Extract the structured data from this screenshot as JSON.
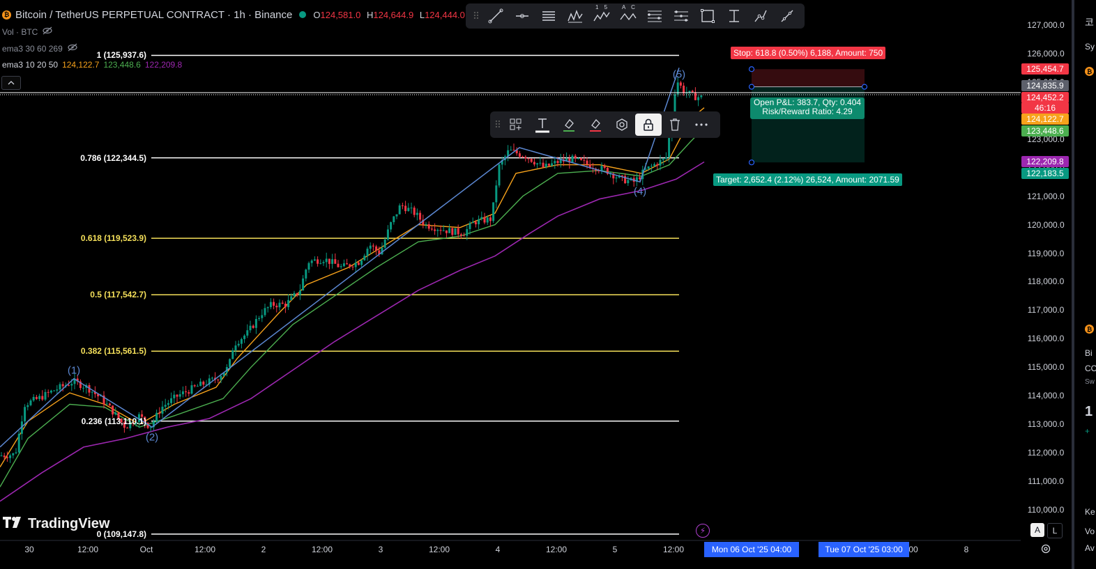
{
  "header": {
    "symbol": "Bitcoin / TetherUS PERPETUAL CONTRACT · 1h · Binance",
    "ohlc": [
      {
        "k": "O",
        "v": "124,581.0"
      },
      {
        "k": "H",
        "v": "124,644.9"
      },
      {
        "k": "L",
        "v": "124,444.0"
      }
    ]
  },
  "indicators": {
    "vol": "Vol · BTC",
    "ema_a": "ema3 30 60 269",
    "ema_b": "ema3 10 20 50",
    "ema_b_values": [
      {
        "value": "124,122.7",
        "color": "#f7a21b"
      },
      {
        "value": "123,448.6",
        "color": "#4caf50"
      },
      {
        "value": "122,209.8",
        "color": "#9c27b0"
      }
    ]
  },
  "collapse_icon": "chevron-up-icon",
  "drawing_toolbar": {
    "tools": [
      "trend-line-icon",
      "ray-icon",
      "parallel-channel-icon",
      "pitchfork-icon",
      "elliott-impulse-icon",
      "elliott-correction-icon",
      "fib-retracement-icon",
      "fib-extension-icon",
      "rectangle-icon",
      "price-range-icon",
      "path-icon",
      "brush-icon"
    ],
    "wave_labels_a": "1 5",
    "wave_labels_b": "A C"
  },
  "edit_toolbar": {
    "tools": [
      "templates-icon",
      "text-icon",
      "line-color-icon",
      "fill-color-icon",
      "settings-icon",
      "lock-icon",
      "trash-icon",
      "more-icon"
    ]
  },
  "price_axis": {
    "labels": [
      "127,000.0",
      "126,000.0",
      "125,000.0",
      "124,000.0",
      "123,000.0",
      "122,000.0",
      "121,000.0",
      "120,000.0",
      "119,000.0",
      "118,000.0",
      "117,000.0",
      "116,000.0",
      "115,000.0",
      "114,000.0",
      "113,000.0",
      "112,000.0",
      "111,000.0",
      "110,000.0"
    ],
    "tags": [
      {
        "text": "125,454.7",
        "bg": "#f23645"
      },
      {
        "text": "124,835.9",
        "bg": "#5d606b"
      },
      {
        "text": "124,452.2",
        "bg": "#f23645"
      },
      {
        "text": "46:16",
        "bg": "#f23645"
      },
      {
        "text": "124,122.7",
        "bg": "#f7a21b"
      },
      {
        "text": "123,448.6",
        "bg": "#4caf50"
      },
      {
        "text": "122,209.8",
        "bg": "#9c27b0"
      },
      {
        "text": "122,183.5",
        "bg": "#089981"
      }
    ]
  },
  "time_axis": {
    "labels": [
      "30",
      "12:00",
      "Oct",
      "12:00",
      "2",
      "12:00",
      "3",
      "12:00",
      "4",
      "12:00",
      "5",
      "12:00",
      "00",
      "8"
    ],
    "crosshair_start": "Mon 06 Oct '25   04:00",
    "crosshair_end": "Tue 07 Oct '25   03:00"
  },
  "fibonacci": [
    {
      "label": "1 (125,937.6)",
      "price": 125937.6,
      "color": "#ffffff"
    },
    {
      "label": "0.786 (122,344.5)",
      "price": 122344.5,
      "color": "#ffffff"
    },
    {
      "label": "0.618 (119,523.9)",
      "price": 119523.9,
      "color": "#f5e05a"
    },
    {
      "label": "0.5 (117,542.7)",
      "price": 117542.7,
      "color": "#f5e05a"
    },
    {
      "label": "0.382 (115,561.5)",
      "price": 115561.5,
      "color": "#f5e05a"
    },
    {
      "label": "0.236 (113,110.1)",
      "price": 113110.1,
      "color": "#ffffff"
    },
    {
      "label": "0 (109,147.8)",
      "price": 109147.8,
      "color": "#ffffff"
    }
  ],
  "elliott_waves": [
    {
      "label": "(1)"
    },
    {
      "label": "(2)"
    },
    {
      "label": "(4)"
    },
    {
      "label": "(5)"
    }
  ],
  "position": {
    "stop": "Stop: 618.8 (0.50%) 6,188, Amount: 750",
    "pnl_line1": "Open P&L: 383.7, Qty: 0.404",
    "pnl_line2": "Risk/Reward Ratio: 4.29",
    "target": "Target: 2,652.4 (2.12%) 26,524, Amount: 2071.59",
    "entry_price": 124835.9,
    "stop_price": 125454.7,
    "target_price": 122183.5
  },
  "watermark": "TradingView",
  "bolt_icon": "lightning-icon",
  "buttons": {
    "auto": "A",
    "log": "L"
  },
  "settings_icon": "gear-icon",
  "right_panel": {
    "items": [
      "코",
      "Sy",
      "Bi",
      "CO",
      "Sw",
      "1",
      "+",
      "Ke",
      "Vo",
      "Av"
    ]
  },
  "colors": {
    "up": "#089981",
    "down": "#f23645",
    "ema_fast": "#f7a21b",
    "ema_mid": "#4caf50",
    "ema_slow": "#9c27b0",
    "wave_line": "#5b87d1"
  },
  "chart_data": {
    "type": "candlestick",
    "timeframe": "1h",
    "ylim": [
      109500,
      127400
    ],
    "close_path": [
      {
        "x": 0,
        "y": 111900
      },
      {
        "x": 22,
        "y": 111950
      },
      {
        "x": 35,
        "y": 113700
      },
      {
        "x": 55,
        "y": 113900
      },
      {
        "x": 78,
        "y": 114200
      },
      {
        "x": 105,
        "y": 114500
      },
      {
        "x": 125,
        "y": 114300
      },
      {
        "x": 145,
        "y": 113900
      },
      {
        "x": 160,
        "y": 113500
      },
      {
        "x": 180,
        "y": 112900
      },
      {
        "x": 200,
        "y": 113300
      },
      {
        "x": 215,
        "y": 112900
      },
      {
        "x": 232,
        "y": 113600
      },
      {
        "x": 255,
        "y": 114000
      },
      {
        "x": 280,
        "y": 114300
      },
      {
        "x": 310,
        "y": 114600
      },
      {
        "x": 328,
        "y": 115000
      },
      {
        "x": 335,
        "y": 115800
      },
      {
        "x": 355,
        "y": 116200
      },
      {
        "x": 375,
        "y": 116900
      },
      {
        "x": 390,
        "y": 117200
      },
      {
        "x": 410,
        "y": 117200
      },
      {
        "x": 430,
        "y": 117700
      },
      {
        "x": 442,
        "y": 118700
      },
      {
        "x": 465,
        "y": 118800
      },
      {
        "x": 490,
        "y": 118500
      },
      {
        "x": 515,
        "y": 118700
      },
      {
        "x": 530,
        "y": 119300
      },
      {
        "x": 545,
        "y": 119000
      },
      {
        "x": 560,
        "y": 120000
      },
      {
        "x": 575,
        "y": 120700
      },
      {
        "x": 595,
        "y": 120400
      },
      {
        "x": 610,
        "y": 120000
      },
      {
        "x": 640,
        "y": 119800
      },
      {
        "x": 665,
        "y": 119700
      },
      {
        "x": 680,
        "y": 120100
      },
      {
        "x": 705,
        "y": 120200
      },
      {
        "x": 715,
        "y": 122000
      },
      {
        "x": 730,
        "y": 122600
      },
      {
        "x": 755,
        "y": 122400
      },
      {
        "x": 780,
        "y": 122000
      },
      {
        "x": 800,
        "y": 122200
      },
      {
        "x": 820,
        "y": 122300
      },
      {
        "x": 845,
        "y": 122100
      },
      {
        "x": 870,
        "y": 121900
      },
      {
        "x": 890,
        "y": 121600
      },
      {
        "x": 910,
        "y": 121500
      },
      {
        "x": 925,
        "y": 121900
      },
      {
        "x": 945,
        "y": 122200
      },
      {
        "x": 955,
        "y": 122300
      },
      {
        "x": 962,
        "y": 123400
      },
      {
        "x": 970,
        "y": 125100
      },
      {
        "x": 980,
        "y": 124700
      },
      {
        "x": 995,
        "y": 124500
      },
      {
        "x": 1010,
        "y": 124450
      }
    ],
    "ema_fast": [
      {
        "x": 0,
        "y": 111500
      },
      {
        "x": 40,
        "y": 113100
      },
      {
        "x": 100,
        "y": 114100
      },
      {
        "x": 150,
        "y": 113700
      },
      {
        "x": 200,
        "y": 113000
      },
      {
        "x": 250,
        "y": 113700
      },
      {
        "x": 310,
        "y": 114300
      },
      {
        "x": 340,
        "y": 115300
      },
      {
        "x": 400,
        "y": 116900
      },
      {
        "x": 440,
        "y": 117900
      },
      {
        "x": 500,
        "y": 118500
      },
      {
        "x": 560,
        "y": 119400
      },
      {
        "x": 600,
        "y": 120000
      },
      {
        "x": 660,
        "y": 119900
      },
      {
        "x": 710,
        "y": 120400
      },
      {
        "x": 740,
        "y": 121800
      },
      {
        "x": 800,
        "y": 122100
      },
      {
        "x": 860,
        "y": 122100
      },
      {
        "x": 920,
        "y": 121800
      },
      {
        "x": 960,
        "y": 122300
      },
      {
        "x": 990,
        "y": 123700
      },
      {
        "x": 1010,
        "y": 124100
      }
    ],
    "ema_mid": [
      {
        "x": 0,
        "y": 110800
      },
      {
        "x": 40,
        "y": 112500
      },
      {
        "x": 100,
        "y": 113700
      },
      {
        "x": 150,
        "y": 113600
      },
      {
        "x": 200,
        "y": 112900
      },
      {
        "x": 250,
        "y": 113300
      },
      {
        "x": 320,
        "y": 113900
      },
      {
        "x": 360,
        "y": 115000
      },
      {
        "x": 420,
        "y": 116500
      },
      {
        "x": 480,
        "y": 117500
      },
      {
        "x": 540,
        "y": 118500
      },
      {
        "x": 600,
        "y": 119400
      },
      {
        "x": 660,
        "y": 119600
      },
      {
        "x": 710,
        "y": 120000
      },
      {
        "x": 750,
        "y": 121000
      },
      {
        "x": 800,
        "y": 121800
      },
      {
        "x": 860,
        "y": 121900
      },
      {
        "x": 920,
        "y": 121700
      },
      {
        "x": 960,
        "y": 122100
      },
      {
        "x": 990,
        "y": 122900
      },
      {
        "x": 1010,
        "y": 123400
      }
    ],
    "ema_slow": [
      {
        "x": 0,
        "y": 110300
      },
      {
        "x": 60,
        "y": 111300
      },
      {
        "x": 120,
        "y": 112200
      },
      {
        "x": 180,
        "y": 112500
      },
      {
        "x": 240,
        "y": 112900
      },
      {
        "x": 300,
        "y": 113200
      },
      {
        "x": 360,
        "y": 113900
      },
      {
        "x": 420,
        "y": 114900
      },
      {
        "x": 480,
        "y": 115900
      },
      {
        "x": 540,
        "y": 116800
      },
      {
        "x": 600,
        "y": 117700
      },
      {
        "x": 660,
        "y": 118400
      },
      {
        "x": 710,
        "y": 118900
      },
      {
        "x": 760,
        "y": 119700
      },
      {
        "x": 800,
        "y": 120300
      },
      {
        "x": 860,
        "y": 120900
      },
      {
        "x": 920,
        "y": 121200
      },
      {
        "x": 970,
        "y": 121600
      },
      {
        "x": 1010,
        "y": 122200
      }
    ]
  }
}
